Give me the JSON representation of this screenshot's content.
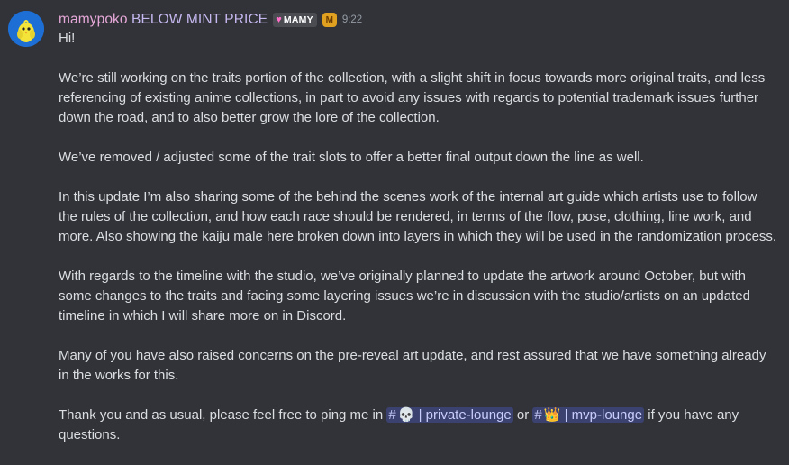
{
  "message": {
    "author": {
      "name_first": "mamypoko",
      "name_rest": " BELOW MINT PRICE",
      "role_tag_icon": "heart-icon",
      "role_tag_label": "MAMY",
      "badge_icon": "guild-badge-icon",
      "badge_glyph": "M",
      "avatar_icon": "yellow-chick-avatar"
    },
    "timestamp": "9:22",
    "greeting": "Hi!",
    "paragraphs": [
      "We’re still working on the traits portion of the collection, with a slight shift in focus towards more original traits, and less referencing of existing anime collections, in part to avoid any issues with regards to potential trademark issues further down the road, and to also better grow the lore of the collection.",
      "We’ve removed / adjusted some of the trait slots to offer a better final output down the line as well.",
      "In this update I’m also sharing some of the behind the scenes work of the internal art guide which artists use to follow the rules of the collection, and how each race should be rendered, in terms of the flow, pose, clothing, line work, and more. Also showing the kaiju male here broken down into layers in which they will be used in the randomization process.",
      "With regards to the timeline with the studio, we’ve originally planned to update the artwork around October, but with some changes to the traits and facing some layering issues we’re in discussion with the studio/artists on an updated timeline in which I will share more on in Discord.",
      "Many of you have also raised concerns on the pre-reveal art update, and rest assured that we have something already in the works for this."
    ],
    "closing": {
      "before": "Thank you and as usual, please feel free to ping me in ",
      "channel1": {
        "hash": "#",
        "emoji": "💀",
        "name": " | private-lounge"
      },
      "between": " or ",
      "channel2": {
        "hash": "#",
        "emoji": "👑",
        "name": " | mvp-lounge"
      },
      "after": " if you have any questions."
    }
  },
  "colors": {
    "background": "#313338",
    "text": "#dbdee1",
    "username": "#e6a8d8",
    "mention_bg": "#3c4270",
    "mention_text": "#c9cdfb",
    "timestamp": "#949ba4"
  }
}
